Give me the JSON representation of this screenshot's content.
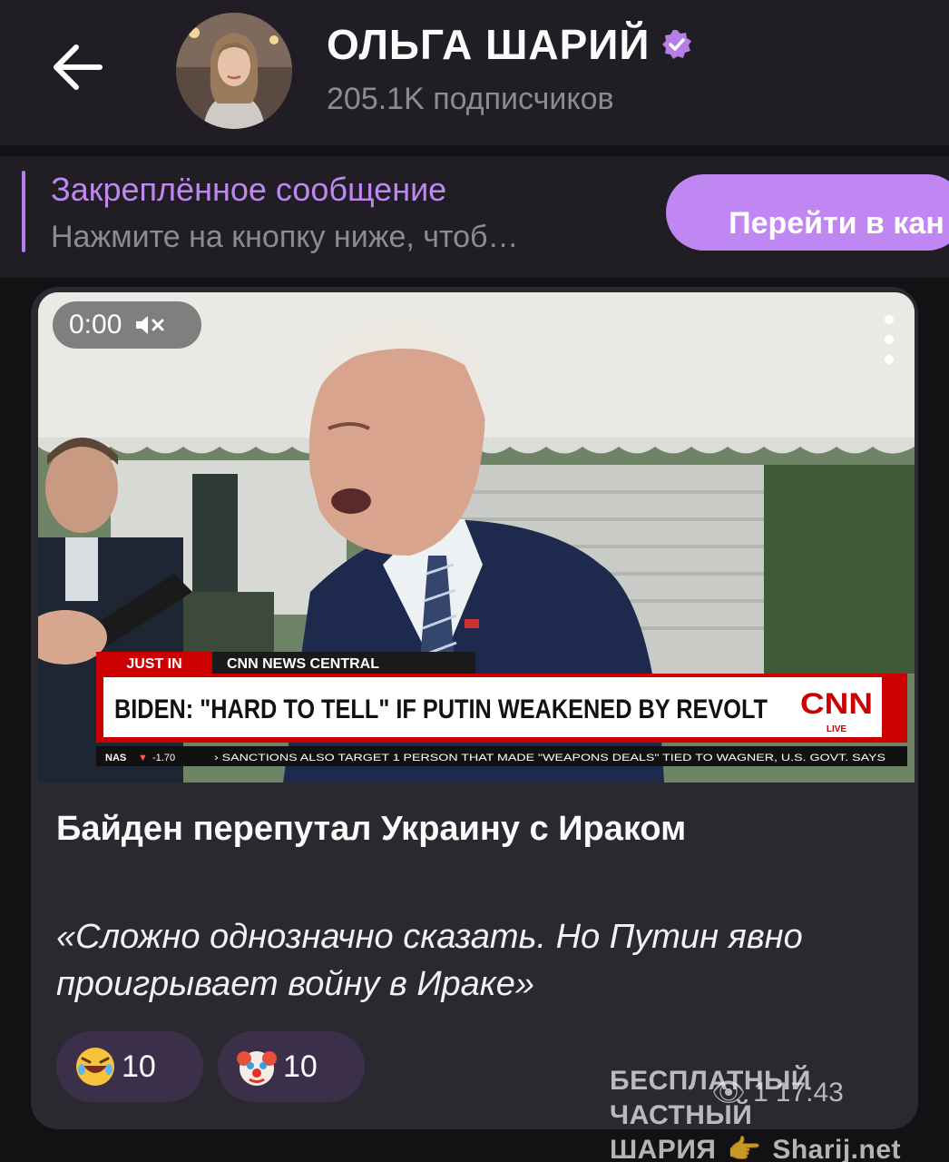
{
  "channel": {
    "title": "ОЛЬГА ШАРИЙ",
    "subscribers": "205.1K подписчиков"
  },
  "pinned": {
    "title": "Закреплённое сообщение",
    "text": "Нажмите на кнопку ниже, чтоб…",
    "button_label": "Перейти в кан"
  },
  "post": {
    "video": {
      "time": "0:00",
      "bug_label": "JUST IN",
      "show_label": "CNN NEWS CENTRAL",
      "chyron": "BIDEN: \"HARD TO TELL\" IF PUTIN WEAKENED BY REVOLT",
      "network": "CNN",
      "live_label": "LIVE",
      "ticker_index": "NAS",
      "ticker_value": "-1.70",
      "ticker_text": "› SANCTIONS ALSO TARGET 1 PERSON THAT MADE \"WEAPONS DEALS\" TIED TO WAGNER, U.S. GOVT. SAYS"
    },
    "headline": "Байден перепутал Украину с Ираком",
    "quote": "«Сложно однозначно сказать. Но Путин явно проигрывает войну в Ираке»",
    "reactions": [
      {
        "icon": "rofl-emoji-icon",
        "count": "10"
      },
      {
        "icon": "clown-emoji-icon",
        "count": "10"
      }
    ],
    "views": "1",
    "time": "17:43"
  },
  "watermark": {
    "line1": "БЕСПЛАТНЫЙ ЧАСТНЫЙ",
    "line2a": "ШАРИЯ",
    "line2b": "Sharij.net"
  },
  "colors": {
    "accent": "#bf88f0",
    "header_bg": "#201e24",
    "card_bg": "#2b2930",
    "cnn_red": "#cc0000"
  }
}
